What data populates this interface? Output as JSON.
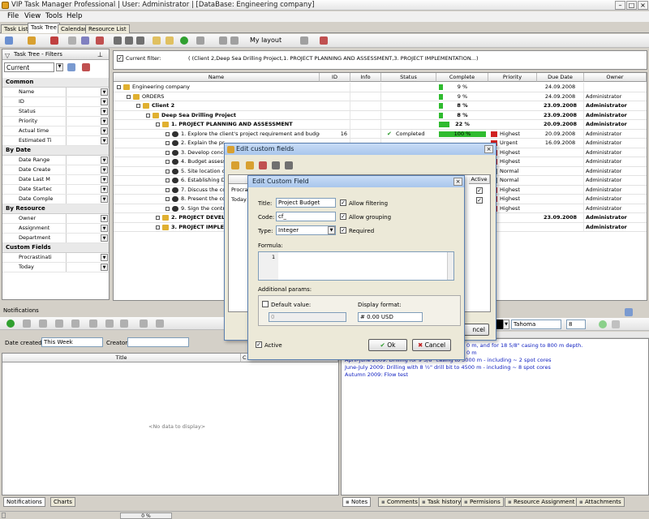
{
  "window": {
    "title": "VIP Task Manager Professional | User: Administrator | [DataBase: Engineering company]"
  },
  "menu": [
    "File",
    "View",
    "Tools",
    "Help"
  ],
  "tabs": [
    "Task List",
    "Task Tree",
    "Calendar",
    "Resource List"
  ],
  "toolbar": {
    "layout_label": "My layout"
  },
  "filter_panel": {
    "title": "Task Tree - Filters",
    "current": "Current",
    "categories": [
      {
        "label": "Common",
        "items": [
          "Name",
          "ID",
          "Status",
          "Priority",
          "Actual time",
          "Estimated Ti"
        ]
      },
      {
        "label": "By Date",
        "items": [
          "Date Range",
          "Date Create",
          "Date Last M",
          "Date Startec",
          "Date Comple"
        ]
      },
      {
        "label": "By Resource",
        "items": [
          "Owner",
          "Assignment",
          "Department"
        ]
      },
      {
        "label": "Custom Fields",
        "items": [
          "Procrastinati",
          "Today"
        ]
      }
    ]
  },
  "current_filter": {
    "label": "Current filter:",
    "value": "( (Client 2,Deep Sea Drilling Project,1. PROJECT PLANNING AND ASSESSMENT,3. PROJECT IMPLEMENTATION...)"
  },
  "grid": {
    "columns": [
      "Name",
      "ID",
      "Info",
      "Status",
      "Complete",
      "Priority",
      "Due Date",
      "Owner"
    ],
    "rows": [
      {
        "name": "Engineering company",
        "level": 0,
        "bold": false,
        "id": "",
        "status": "",
        "complete": "9 %",
        "pct": 9,
        "priority": "",
        "due": "24.09.2008",
        "owner": ""
      },
      {
        "name": "ORDERS",
        "level": 1,
        "bold": false,
        "id": "",
        "status": "",
        "complete": "9 %",
        "pct": 9,
        "priority": "",
        "due": "24.09.2008",
        "owner": "Administrator"
      },
      {
        "name": "Client 2",
        "level": 2,
        "bold": true,
        "id": "",
        "status": "",
        "complete": "8 %",
        "pct": 8,
        "priority": "",
        "due": "23.09.2008",
        "owner": "Administrator"
      },
      {
        "name": "Deep Sea Drilling Project",
        "level": 3,
        "bold": true,
        "id": "",
        "status": "",
        "complete": "8 %",
        "pct": 8,
        "priority": "",
        "due": "23.09.2008",
        "owner": "Administrator"
      },
      {
        "name": "1. PROJECT PLANNING AND ASSESSMENT",
        "level": 4,
        "bold": true,
        "id": "",
        "status": "",
        "complete": "22 %",
        "pct": 22,
        "priority": "",
        "due": "20.09.2008",
        "owner": "Administrator"
      },
      {
        "name": "1. Explore the client's project requirement and budget",
        "level": 5,
        "bold": false,
        "id": "16",
        "status": "Completed",
        "complete": "100 %",
        "pct": 100,
        "priority": "Highest",
        "due": "20.09.2008",
        "owner": "Administrator"
      },
      {
        "name": "2. Explain the pr",
        "level": 5,
        "bold": false,
        "id": "",
        "status": "",
        "complete": "",
        "pct": 0,
        "priority": "Urgent",
        "due": "16.09.2008",
        "owner": "Administrator"
      },
      {
        "name": "3. Develop conce",
        "level": 5,
        "bold": false,
        "id": "",
        "status": "",
        "complete": "",
        "pct": 0,
        "priority": "Highest",
        "due": "",
        "owner": "Administrator"
      },
      {
        "name": "4. Budget assess",
        "level": 5,
        "bold": false,
        "id": "",
        "status": "",
        "complete": "",
        "pct": 0,
        "priority": "Highest",
        "due": "",
        "owner": "Administrator"
      },
      {
        "name": "5. Site location o",
        "level": 5,
        "bold": false,
        "id": "",
        "status": "",
        "complete": "",
        "pct": 0,
        "priority": "Normal",
        "due": "",
        "owner": "Administrator"
      },
      {
        "name": "6. Establishing Dr",
        "level": 5,
        "bold": false,
        "id": "",
        "status": "",
        "complete": "",
        "pct": 0,
        "priority": "Normal",
        "due": "",
        "owner": "Administrator"
      },
      {
        "name": "7. Discuss the co",
        "level": 5,
        "bold": false,
        "id": "",
        "status": "",
        "complete": "",
        "pct": 0,
        "priority": "Highest",
        "due": "",
        "owner": "Administrator"
      },
      {
        "name": "8. Present the co",
        "level": 5,
        "bold": false,
        "id": "",
        "status": "",
        "complete": "",
        "pct": 0,
        "priority": "Highest",
        "due": "",
        "owner": "Administrator"
      },
      {
        "name": "9. Sign the contr",
        "level": 5,
        "bold": false,
        "id": "",
        "status": "",
        "complete": "",
        "pct": 0,
        "priority": "Highest",
        "due": "",
        "owner": "Administrator"
      },
      {
        "name": "2. PROJECT DEVELO",
        "level": 4,
        "bold": true,
        "id": "",
        "status": "",
        "complete": "",
        "pct": 0,
        "priority": "",
        "due": "23.09.2008",
        "owner": "Administrator"
      },
      {
        "name": "3. PROJECT IMPLE",
        "level": 4,
        "bold": true,
        "id": "",
        "status": "",
        "complete": "",
        "pct": 0,
        "priority": "",
        "due": "",
        "owner": "Administrator"
      }
    ]
  },
  "notifications": {
    "title": "Notifications",
    "date_created_label": "Date created:",
    "date_value": "This Week",
    "creator_label": "Creator:",
    "col_title": "Title",
    "col_c": "C",
    "empty": "<No data to display>",
    "tabs": [
      "Notifications",
      "Charts"
    ]
  },
  "notes": {
    "font": "Tahoma",
    "size": "8",
    "lines": [
      "0 m, and for 18 5/8\" casing to 800 m depth.",
      "0 m",
      "April-June 2009:     Drilling for 9 5/8\" casing to 3000 m - including ~ 2 spot cores",
      "June-July 2009:     Drilling with 8 ½\" drill bit to 4500 m - including ~ 8 spot cores",
      "Autumn 2009:     Flow test"
    ],
    "tabs": [
      "Notes",
      "Comments",
      "Task history",
      "Permisions",
      "Resource Assignment",
      "Attachments"
    ]
  },
  "dialog_custom_fields": {
    "title": "Edit custom fields",
    "partial_col": "Active",
    "partial_rows": [
      "Procra",
      "Today"
    ],
    "cancel_partial": "ncel"
  },
  "dialog_edit_field": {
    "title": "Edit Custom Field",
    "title_label": "Title:",
    "title_value": "Project Budget",
    "code_label": "Code:",
    "code_value": "cf_",
    "type_label": "Type:",
    "type_value": "Integer",
    "allow_filtering": "Allow filtering",
    "allow_grouping": "Allow grouping",
    "required": "Required",
    "formula_label": "Formula:",
    "formula_line": "1",
    "additional_params": "Additional params:",
    "default_value": "Default value:",
    "default_num": "0",
    "display_format": "Display format:",
    "display_format_value": "# 0.00 USD",
    "active": "Active",
    "ok": "Ok",
    "cancel": "Cancel"
  },
  "statusbar": {
    "progress": "0 %"
  }
}
